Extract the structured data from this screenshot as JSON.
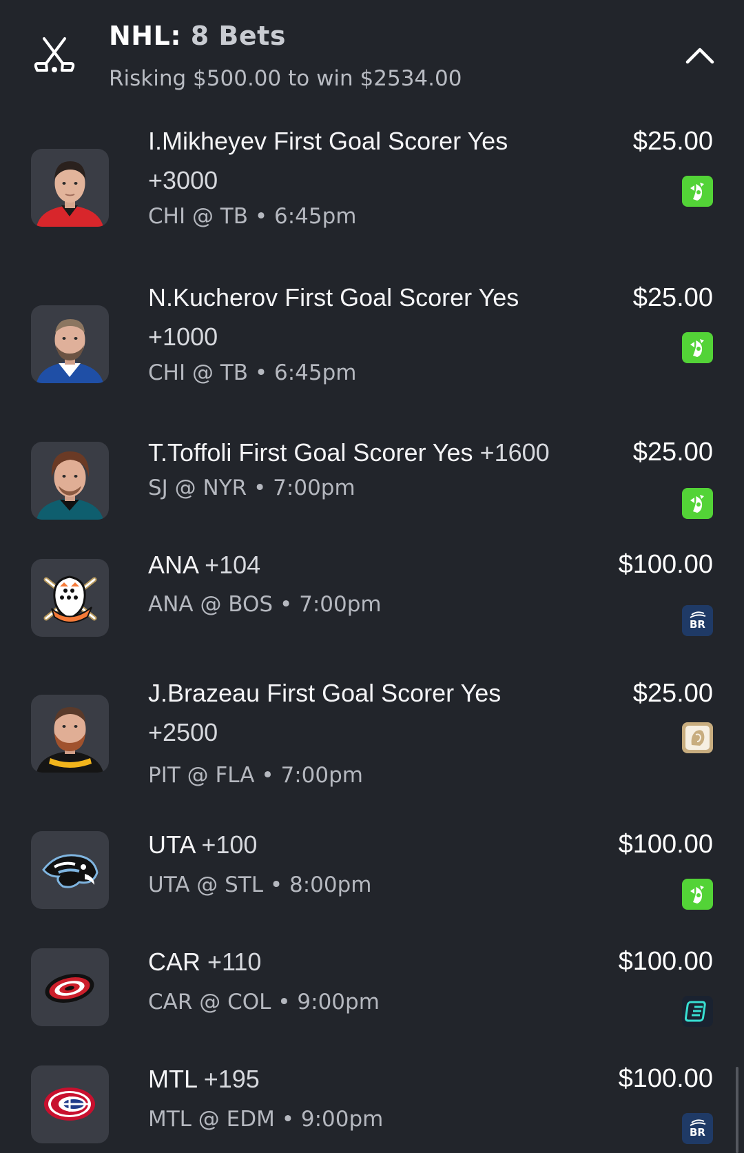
{
  "header": {
    "icon": "hockey-sticks-icon",
    "league": "NHL:",
    "count": "8 Bets",
    "subtitle": "Risking $500.00 to win $2534.00",
    "collapse_icon": "chevron-up-icon"
  },
  "colors": {
    "background": "#22252b",
    "draftkings_green": "#53d337",
    "betrivers_navy": "#1f3a66",
    "bet365_gold": "#c8ad7f",
    "espnbet_teal": "#1a2230"
  },
  "bets": [
    {
      "avatar": "player-headshot",
      "title": "I.Mikheyev First Goal Scorer Yes",
      "odds": "+3000",
      "meta": "CHI @ TB • 6:45pm",
      "amount": "$25.00",
      "book": "draftkings-logo"
    },
    {
      "avatar": "player-headshot",
      "title": "N.Kucherov First Goal Scorer Yes",
      "odds": "+1000",
      "meta": "CHI @ TB • 6:45pm",
      "amount": "$25.00",
      "book": "draftkings-logo"
    },
    {
      "avatar": "player-headshot",
      "title": "T.Toffoli First Goal Scorer Yes",
      "odds": "+1600",
      "meta": "SJ @ NYR • 7:00pm",
      "amount": "$25.00",
      "book": "draftkings-logo"
    },
    {
      "avatar": "ducks-logo",
      "title": "ANA",
      "odds": "+104",
      "meta": "ANA @ BOS • 7:00pm",
      "amount": "$100.00",
      "book": "betrivers-logo",
      "book_text": "BR"
    },
    {
      "avatar": "player-headshot",
      "title": "J.Brazeau First Goal Scorer Yes",
      "odds": "+2500",
      "meta": "PIT @ FLA • 7:00pm",
      "amount": "$25.00",
      "book": "betmgm-logo"
    },
    {
      "avatar": "utah-logo",
      "title": "UTA",
      "odds": "+100",
      "meta": "UTA @ STL • 8:00pm",
      "amount": "$100.00",
      "book": "draftkings-logo"
    },
    {
      "avatar": "hurricanes-logo",
      "title": "CAR",
      "odds": "+110",
      "meta": "CAR @ COL • 9:00pm",
      "amount": "$100.00",
      "book": "espnbet-logo"
    },
    {
      "avatar": "canadiens-logo",
      "title": "MTL",
      "odds": "+195",
      "meta": "MTL @ EDM • 9:00pm",
      "amount": "$100.00",
      "book": "betrivers-logo",
      "book_text": "BR"
    }
  ]
}
